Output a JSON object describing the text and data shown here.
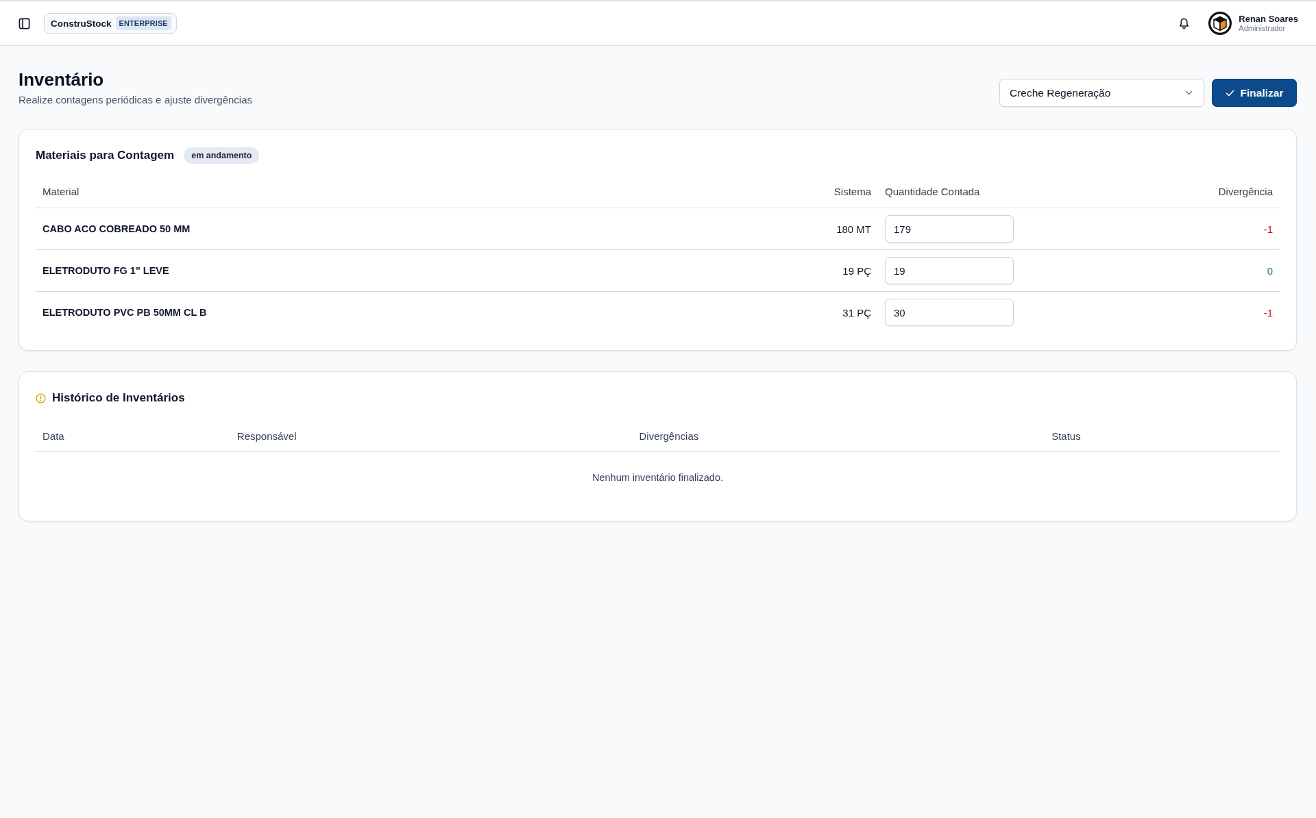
{
  "topbar": {
    "brand": {
      "name": "ConstruStock",
      "plan": "ENTERPRISE"
    },
    "user": {
      "name": "Renan Soares",
      "role": "Administrador"
    }
  },
  "page_header": {
    "title": "Inventário",
    "subtitle": "Realize contagens periódicas e ajuste divergências",
    "location_select": {
      "value": "Creche Regeneração"
    },
    "finalize_button": {
      "label": "Finalizar"
    }
  },
  "count_card": {
    "title": "Materiais para Contagem",
    "status_badge": "em andamento",
    "columns": [
      "Material",
      "Sistema",
      "Quantidade Contada",
      "Divergência"
    ],
    "rows": [
      {
        "material": "CABO ACO COBREADO 50 MM",
        "system": "180 MT",
        "counted": "179",
        "divergence": "-1",
        "color": "#c0151c"
      },
      {
        "material": "ELETRODUTO FG 1\" LEVE",
        "system": "19 PÇ",
        "counted": "19",
        "divergence": "0",
        "color": "#168a3e"
      },
      {
        "material": "ELETRODUTO PVC PB 50MM CL B",
        "system": "31 PÇ",
        "counted": "30",
        "divergence": "-1",
        "color": "#c0151c"
      }
    ]
  },
  "history_card": {
    "title": "Histórico de Inventários",
    "columns": [
      "Data",
      "Responsável",
      "Divergências",
      "Status"
    ],
    "empty_message": "Nenhum inventário finalizado."
  }
}
